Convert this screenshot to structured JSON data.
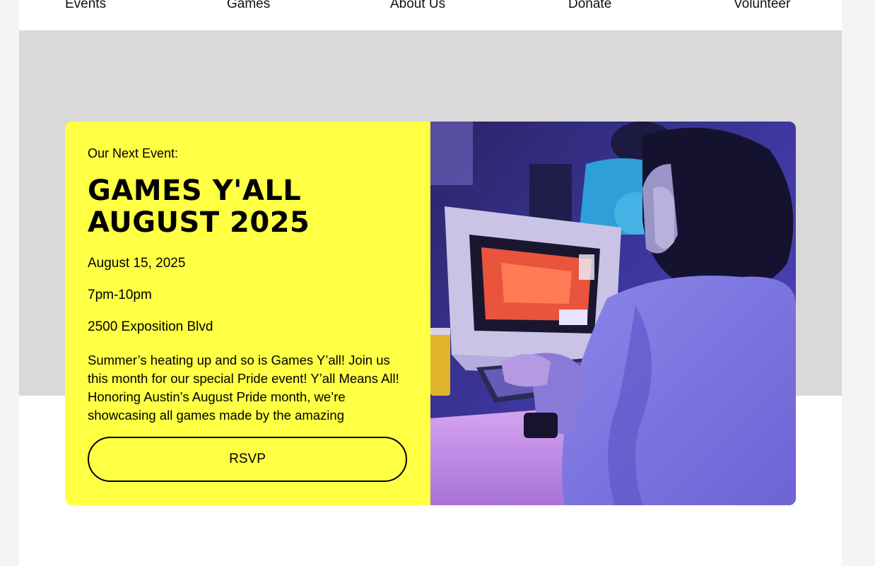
{
  "nav": {
    "items": [
      {
        "label": "Events"
      },
      {
        "label": "Games"
      },
      {
        "label": "About Us"
      },
      {
        "label": "Donate"
      },
      {
        "label": "Volunteer"
      }
    ]
  },
  "event": {
    "eyebrow": "Our Next Event:",
    "title_line1": "GAMES Y'ALL",
    "title_line2": "AUGUST 2025",
    "date": "August 15, 2025",
    "time": "7pm-10pm",
    "address": "2500 Exposition Blvd",
    "description": "Summer’s heating up and so is Games Y’all! Join us this month for our special Pride event! Y’all Means All! Honoring Austin’s August Pride month, we’re showcasing all games made by the amazing",
    "rsvp_label": "RSVP",
    "photo_alt": "Person wearing headphones playing a game on a retro CRT computer"
  },
  "colors": {
    "accent_yellow": "#ffff44",
    "band_gray": "#d9d9d9"
  }
}
